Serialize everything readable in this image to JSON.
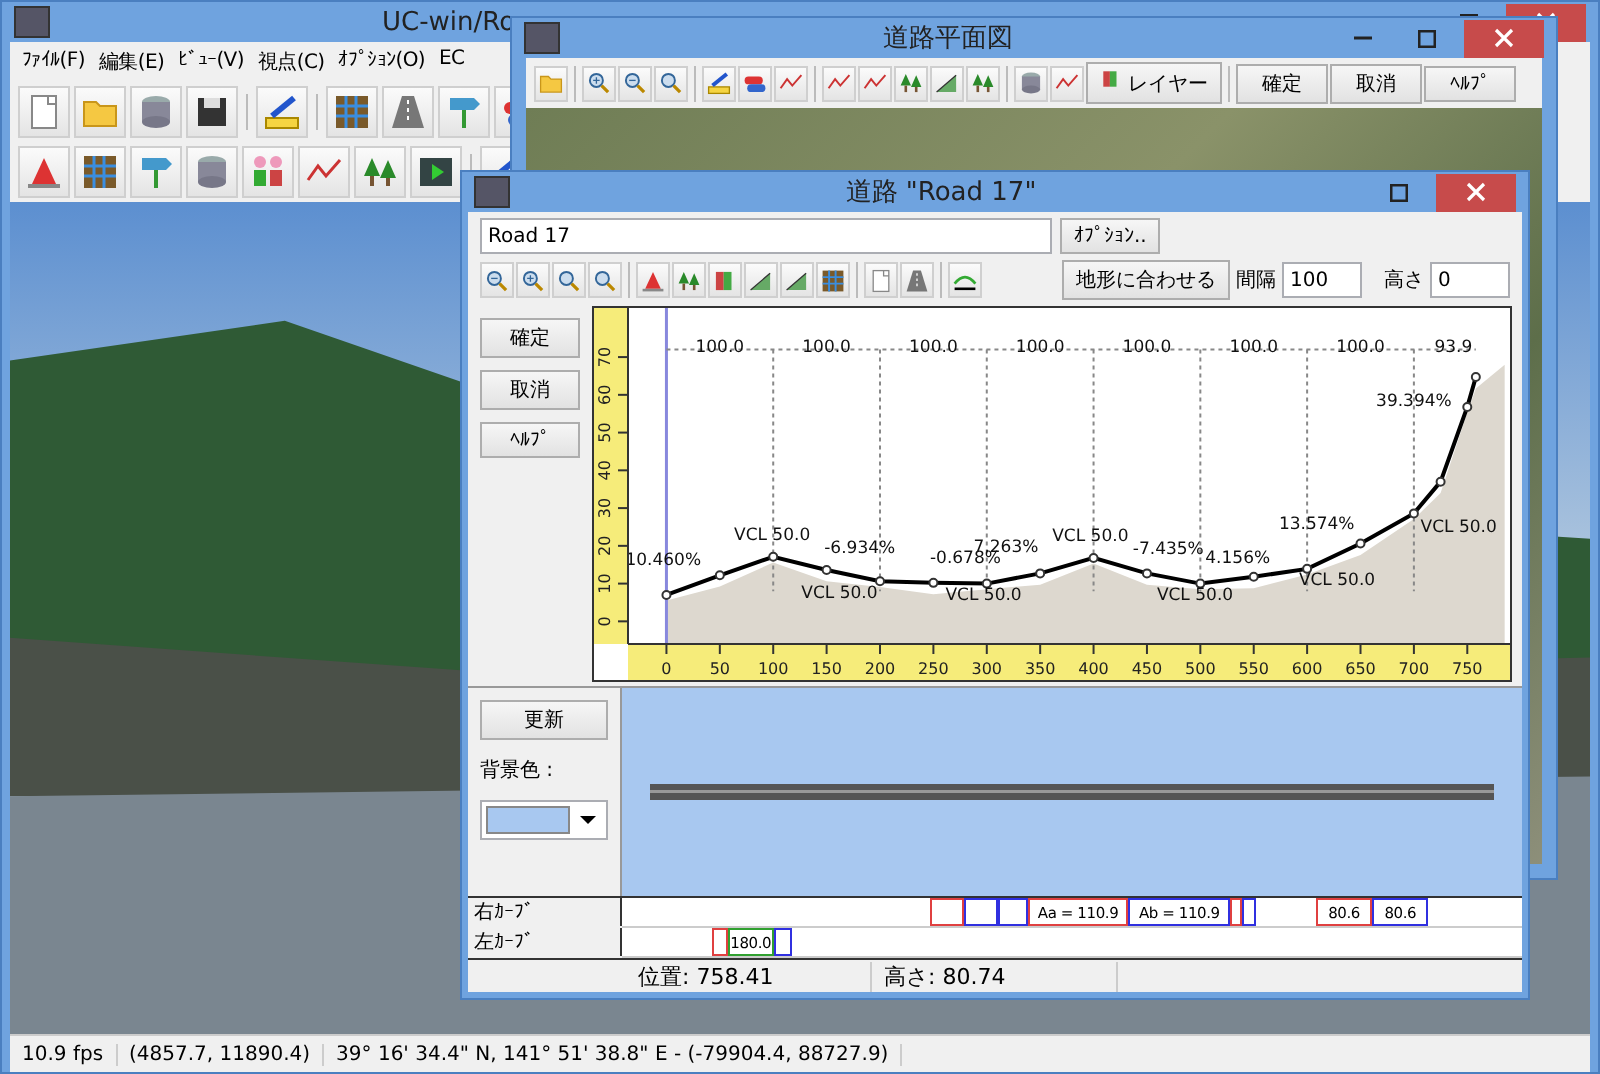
{
  "main_window": {
    "title": "UC-win/Ro",
    "menu": [
      "ﾌｧｲﾙ(F)",
      "編集(E)",
      "ﾋﾞｭｰ(V)",
      "視点(C)",
      "ｵﾌﾟｼｮﾝ(O)",
      "EC"
    ],
    "status_bar": [
      "10.9 fps",
      "(4857.7, 11890.4)",
      "39°  16' 34.4\" N, 141°  51' 38.8\" E  - (-79904.4, 88727.9)"
    ]
  },
  "plan_window": {
    "title": "道路平面図",
    "layer_button": "レイヤー",
    "buttons": [
      "確定",
      "取消",
      "ﾍﾙﾌﾟ"
    ]
  },
  "road_dialog": {
    "title": "道路 \"Road 17\"",
    "name_value": "Road 17",
    "options_button": "ｵﾌﾟｼｮﾝ..",
    "fit_button": "地形に合わせる",
    "interval": {
      "label": "間隔",
      "value": "100"
    },
    "height": {
      "label": "高さ",
      "value": "0"
    },
    "side_buttons": [
      "確定",
      "取消",
      "ﾍﾙﾌﾟ"
    ],
    "profile": {
      "chart_data": {
        "type": "line",
        "grid": true,
        "xlim": [
          -36,
          790
        ],
        "ylim": [
          -6,
          83
        ],
        "xticks": [
          0,
          50,
          100,
          150,
          200,
          250,
          300,
          350,
          400,
          450,
          500,
          550,
          600,
          650,
          700,
          750
        ],
        "yticks": [
          0,
          10,
          20,
          30,
          40,
          50,
          60,
          70
        ],
        "x": [
          0,
          50,
          100,
          150,
          200,
          250,
          300,
          350,
          400,
          450,
          500,
          550,
          600,
          650,
          700,
          725,
          750,
          758
        ],
        "series": [
          {
            "color": "#000000",
            "marker": "o",
            "values": [
              7,
              12.2,
              17.1,
              13.6,
              10.6,
              10.2,
              10,
              12.7,
              16.8,
              12.7,
              10,
              11.8,
              13.9,
              20.6,
              28.6,
              37,
              56.8,
              64.7
            ]
          }
        ],
        "annotations": [
          "100.0",
          "100.0",
          "100.0",
          "100.0",
          "100.0",
          "100.0",
          "100.0",
          "93.9",
          "10.460%",
          "VCL  50.0",
          "-6.934%",
          "VCL  50.0",
          "-0.678%",
          "7.263%",
          "VCL  50.0",
          "VCL  50.0",
          "-7.435%",
          "4.156%",
          "VCL  50.0",
          "13.574%",
          "VCL  50.0",
          "39.394%",
          "VCL  50.0"
        ]
      }
    },
    "update_button": "更新",
    "bg_color_label": "背景色 :",
    "curves": [
      {
        "label": "右ｶｰﾌﾞ",
        "segments": [
          {
            "color": "#e04040"
          },
          {
            "color": "#3030e0"
          },
          {
            "color": "#3030e0"
          },
          {
            "color": "#e04040",
            "text": "Aa = 110.9"
          },
          {
            "color": "#3030e0",
            "text": "Ab = 110.9"
          },
          {
            "color": "#e04040"
          },
          {
            "color": "#3030e0"
          },
          {
            "color": "#e04040",
            "text": "80.6"
          },
          {
            "color": "#3030e0",
            "text": "80.6"
          }
        ]
      },
      {
        "label": "左ｶｰﾌﾞ",
        "segments": [
          {
            "color": "#e04040"
          },
          {
            "color": "#30a030",
            "text": "180.0"
          },
          {
            "color": "#3030e0"
          }
        ]
      }
    ],
    "status": [
      "位置: 758.41",
      "高さ: 80.74"
    ]
  }
}
